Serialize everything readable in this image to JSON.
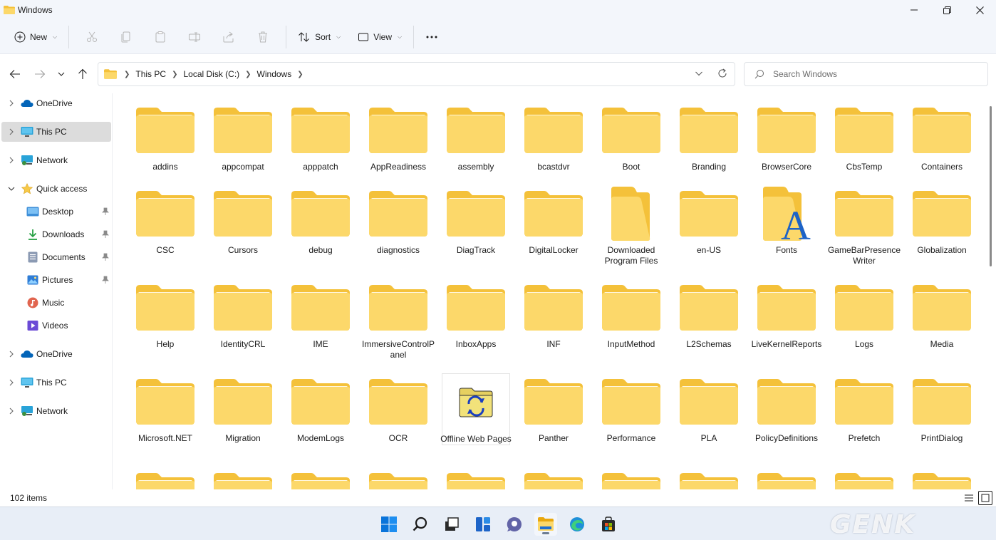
{
  "window": {
    "title": "Windows"
  },
  "toolbar": {
    "new_label": "New",
    "sort_label": "Sort",
    "view_label": "View",
    "more_label": "..."
  },
  "address": {
    "crumbs": [
      "This PC",
      "Local Disk (C:)",
      "Windows"
    ]
  },
  "search": {
    "placeholder": "Search Windows"
  },
  "sidebar": {
    "items": [
      {
        "label": "OneDrive",
        "icon": "onedrive-cloud-icon"
      },
      {
        "label": "This PC",
        "icon": "monitor-icon",
        "selected": true
      },
      {
        "label": "Network",
        "icon": "network-icon"
      },
      {
        "label": "Quick access",
        "icon": "star-icon",
        "expanded": true
      },
      {
        "label": "Desktop",
        "icon": "desktop-icon",
        "pinned": true
      },
      {
        "label": "Downloads",
        "icon": "download-arrow-icon",
        "pinned": true
      },
      {
        "label": "Documents",
        "icon": "document-icon",
        "pinned": true
      },
      {
        "label": "Pictures",
        "icon": "pictures-icon",
        "pinned": true
      },
      {
        "label": "Music",
        "icon": "music-icon"
      },
      {
        "label": "Videos",
        "icon": "videos-icon"
      },
      {
        "label": "OneDrive",
        "icon": "onedrive-cloud-icon"
      },
      {
        "label": "This PC",
        "icon": "monitor-icon"
      },
      {
        "label": "Network",
        "icon": "network-icon"
      }
    ]
  },
  "files": [
    {
      "name": "addins",
      "icon": "folder"
    },
    {
      "name": "appcompat",
      "icon": "folder"
    },
    {
      "name": "apppatch",
      "icon": "folder"
    },
    {
      "name": "AppReadiness",
      "icon": "folder"
    },
    {
      "name": "assembly",
      "icon": "folder"
    },
    {
      "name": "bcastdvr",
      "icon": "folder"
    },
    {
      "name": "Boot",
      "icon": "folder"
    },
    {
      "name": "Branding",
      "icon": "folder"
    },
    {
      "name": "BrowserCore",
      "icon": "folder"
    },
    {
      "name": "CbsTemp",
      "icon": "folder"
    },
    {
      "name": "Containers",
      "icon": "folder"
    },
    {
      "name": "CSC",
      "icon": "folder"
    },
    {
      "name": "Cursors",
      "icon": "folder"
    },
    {
      "name": "debug",
      "icon": "folder"
    },
    {
      "name": "diagnostics",
      "icon": "folder"
    },
    {
      "name": "DiagTrack",
      "icon": "folder"
    },
    {
      "name": "DigitalLocker",
      "icon": "folder"
    },
    {
      "name": "Downloaded Program Files",
      "icon": "folder-open"
    },
    {
      "name": "en-US",
      "icon": "folder"
    },
    {
      "name": "Fonts",
      "icon": "folder-fonts"
    },
    {
      "name": "GameBarPresenceWriter",
      "icon": "folder"
    },
    {
      "name": "Globalization",
      "icon": "folder"
    },
    {
      "name": "Help",
      "icon": "folder"
    },
    {
      "name": "IdentityCRL",
      "icon": "folder"
    },
    {
      "name": "IME",
      "icon": "folder"
    },
    {
      "name": "ImmersiveControlPanel",
      "icon": "folder"
    },
    {
      "name": "InboxApps",
      "icon": "folder"
    },
    {
      "name": "INF",
      "icon": "folder"
    },
    {
      "name": "InputMethod",
      "icon": "folder"
    },
    {
      "name": "L2Schemas",
      "icon": "folder"
    },
    {
      "name": "LiveKernelReports",
      "icon": "folder"
    },
    {
      "name": "Logs",
      "icon": "folder"
    },
    {
      "name": "Media",
      "icon": "folder"
    },
    {
      "name": "Microsoft.NET",
      "icon": "folder"
    },
    {
      "name": "Migration",
      "icon": "folder"
    },
    {
      "name": "ModemLogs",
      "icon": "folder"
    },
    {
      "name": "OCR",
      "icon": "folder"
    },
    {
      "name": "Offline Web Pages",
      "icon": "folder-sync"
    },
    {
      "name": "Panther",
      "icon": "folder"
    },
    {
      "name": "Performance",
      "icon": "folder"
    },
    {
      "name": "PLA",
      "icon": "folder"
    },
    {
      "name": "PolicyDefinitions",
      "icon": "folder"
    },
    {
      "name": "Prefetch",
      "icon": "folder"
    },
    {
      "name": "PrintDialog",
      "icon": "folder"
    },
    {
      "name": "",
      "icon": "folder"
    },
    {
      "name": "",
      "icon": "folder"
    },
    {
      "name": "",
      "icon": "folder"
    },
    {
      "name": "",
      "icon": "folder"
    },
    {
      "name": "",
      "icon": "folder"
    },
    {
      "name": "",
      "icon": "folder"
    },
    {
      "name": "",
      "icon": "folder"
    },
    {
      "name": "",
      "icon": "folder"
    },
    {
      "name": "",
      "icon": "folder"
    },
    {
      "name": "",
      "icon": "folder"
    },
    {
      "name": "",
      "icon": "folder"
    }
  ],
  "status": {
    "item_count": "102 items"
  },
  "taskbar": {
    "apps": [
      "start-icon",
      "search-icon",
      "task-view-icon",
      "widgets-icon",
      "teams-chat-icon",
      "file-explorer-icon",
      "edge-icon",
      "store-icon"
    ],
    "active_app": "file-explorer-icon"
  },
  "watermark": {
    "text": "GENK"
  },
  "colors": {
    "folder_back": "#f4c13a",
    "folder_front": "#fcd86a",
    "accent": "#0067c0",
    "selection": "#dcdcdc"
  }
}
